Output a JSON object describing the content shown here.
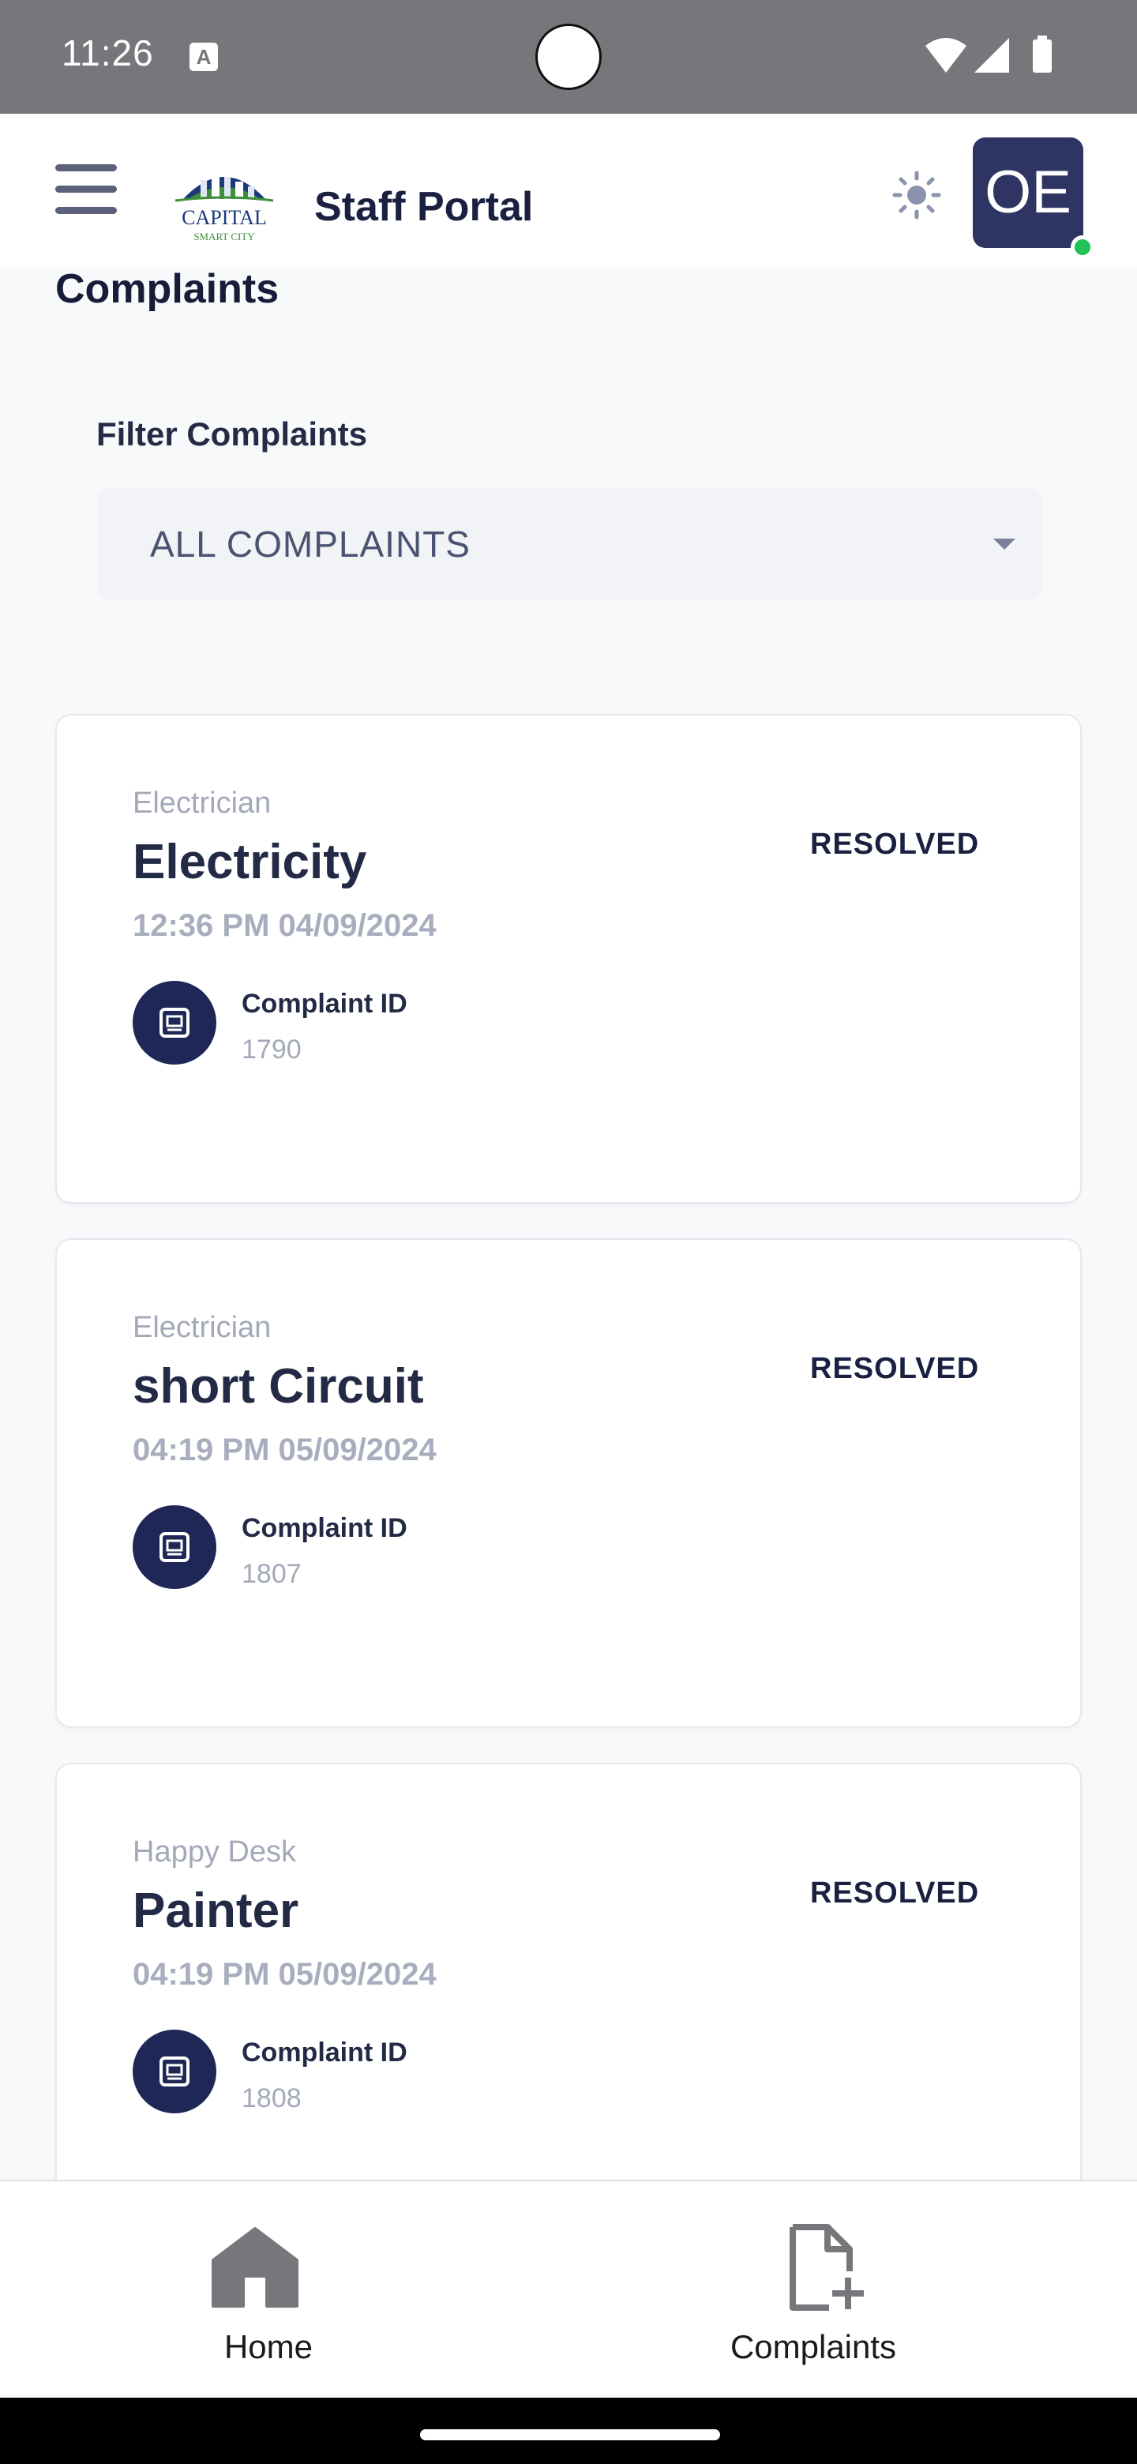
{
  "status_bar": {
    "time": "11:26",
    "notification_glyph": "A",
    "icons": [
      "wifi-icon",
      "signal-icon",
      "battery-icon"
    ]
  },
  "header": {
    "title": "Staff Portal",
    "logo_text": "CAPITAL",
    "logo_subtext": "SMART CITY",
    "avatar_initials": "OE",
    "online_color": "#1fc35a"
  },
  "page": {
    "title": "Complaints",
    "filter": {
      "label": "Filter Complaints",
      "selected": "ALL COMPLAINTS"
    }
  },
  "complaints": [
    {
      "category": "Electrician",
      "title": "Electricity",
      "datetime": "12:36 PM 04/09/2024",
      "status": "RESOLVED",
      "id_label": "Complaint ID",
      "id": "1790"
    },
    {
      "category": "Electrician",
      "title": "short Circuit",
      "datetime": "04:19 PM 05/09/2024",
      "status": "RESOLVED",
      "id_label": "Complaint ID",
      "id": "1807"
    },
    {
      "category": "Happy Desk",
      "title": "Painter",
      "datetime": "04:19 PM 05/09/2024",
      "status": "RESOLVED",
      "id_label": "Complaint ID",
      "id": "1808"
    }
  ],
  "bottom_nav": {
    "home_label": "Home",
    "complaints_label": "Complaints"
  },
  "colors": {
    "accent": "#1e2756",
    "avatar_bg": "#2e3562"
  }
}
